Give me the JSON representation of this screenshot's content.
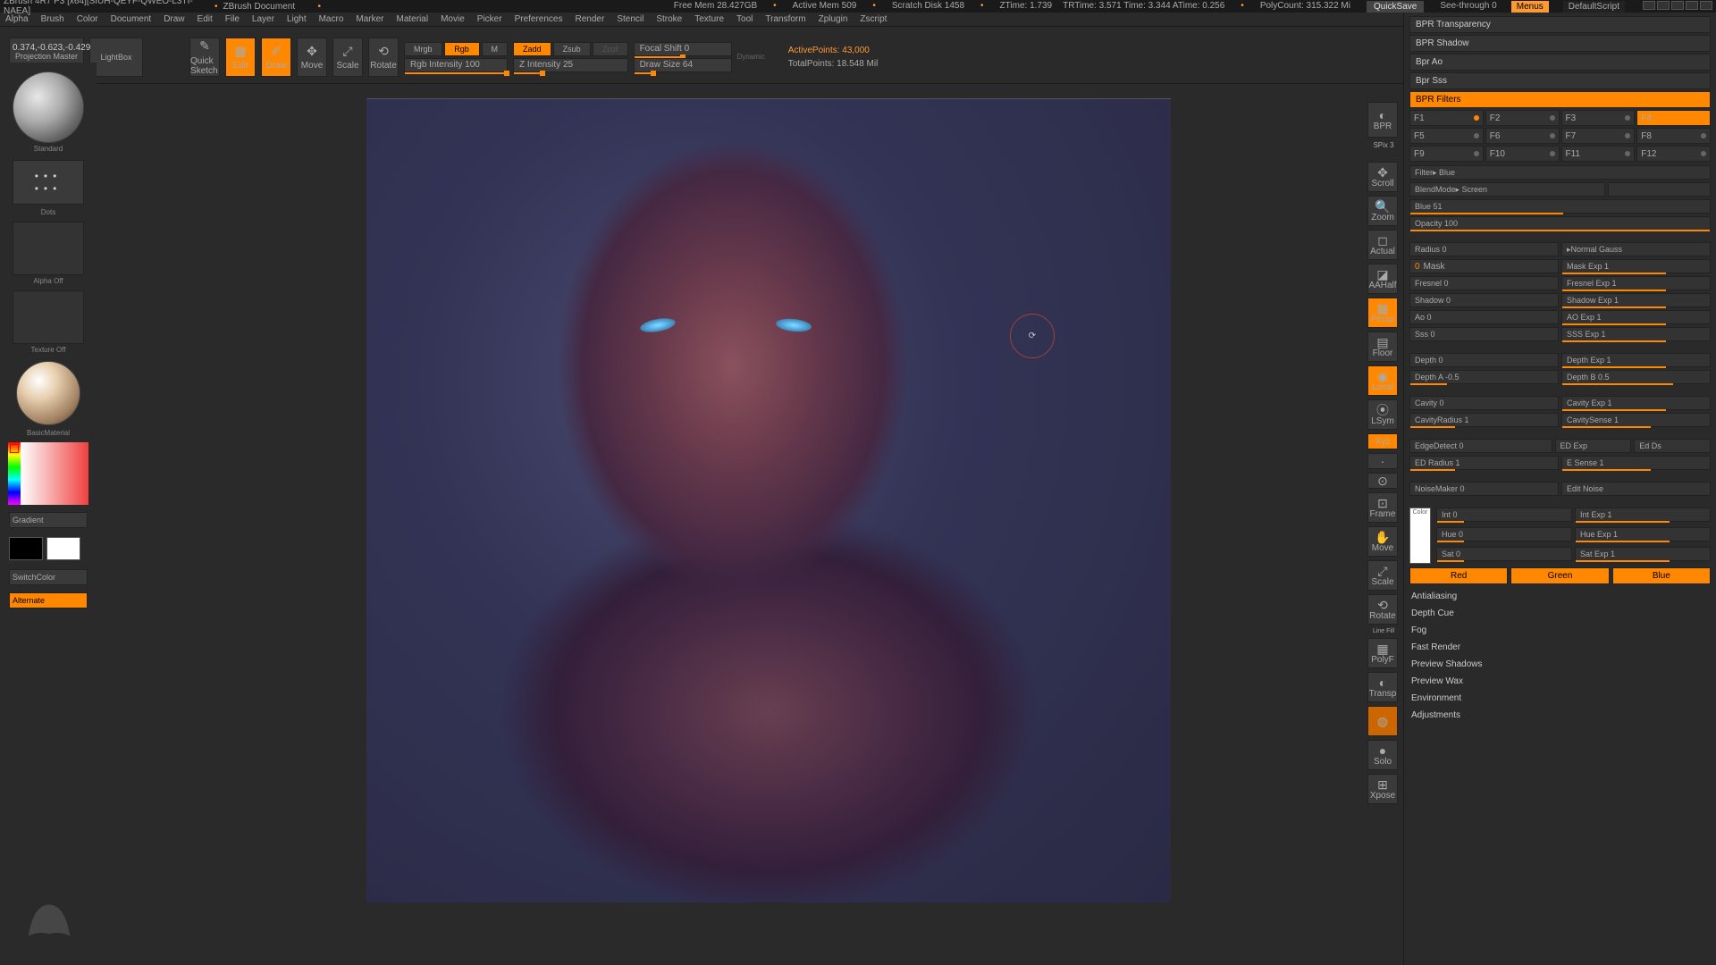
{
  "titlebar": {
    "app": "ZBrush 4R7 P3 [x64][SIUH-QEYF-QWEO-L3TI-NAEA]",
    "document": "ZBrush Document",
    "stats": {
      "freemem": "Free Mem 28.427GB",
      "activemem": "Active Mem 509",
      "scratch": "Scratch Disk 1458",
      "ztime": "ZTime: 1.739",
      "trtime": "TRTime: 3.571 Time: 3.344 ATime: 0.256",
      "polycount": "PolyCount: 315.322 Mi"
    },
    "quicksave": "QuickSave",
    "seethrough": "See-through  0",
    "menus": "Menus",
    "script": "DefaultScript"
  },
  "menubar": [
    "Alpha",
    "Brush",
    "Color",
    "Document",
    "Draw",
    "Edit",
    "File",
    "Layer",
    "Light",
    "Macro",
    "Marker",
    "Material",
    "Movie",
    "Picker",
    "Preferences",
    "Render",
    "Stencil",
    "Stroke",
    "Texture",
    "Tool",
    "Transform",
    "Zplugin",
    "Zscript"
  ],
  "readout": "0.374,-0.623,-0.429",
  "toolbar": {
    "projection": "Projection Master",
    "lightbox": "LightBox",
    "quicksketch": "Quick Sketch",
    "edit": "Edit",
    "draw": "Draw",
    "move": "Move",
    "scale": "Scale",
    "rotate": "Rotate",
    "mrgb": "Mrgb",
    "rgb": "Rgb",
    "m": "M",
    "rgbint": "Rgb Intensity 100",
    "zadd": "Zadd",
    "zsub": "Zsub",
    "zcut": "Zcut",
    "zint": "Z Intensity 25",
    "focal": "Focal Shift 0",
    "drawsize": "Draw Size 64",
    "dynamic": "Dynamic",
    "activepoints": "ActivePoints: 43,000",
    "totalpoints": "TotalPoints: 18.548 Mil"
  },
  "left": {
    "brush": "Standard",
    "stroke": "Dots",
    "alpha": "Alpha Off",
    "texture": "Texture Off",
    "material": "BasicMaterial",
    "gradient": "Gradient",
    "switchcolor": "SwitchColor",
    "alternate": "Alternate"
  },
  "rightside": {
    "bpr": "BPR",
    "spix": "SPix 3",
    "scroll": "Scroll",
    "zoom": "Zoom",
    "actual": "Actual",
    "aahalf": "AAHalf",
    "persp": "Persp",
    "floor": "Floor",
    "local": "Local",
    "lsym": "LSym",
    "xyz": "Xyz",
    "frame": "Frame",
    "move": "Move",
    "scale": "Scale",
    "rotate": "Rotate",
    "linefill": "Line Fill",
    "polyf": "PolyF",
    "transp": "Transp",
    "dynamic": "Dynamic",
    "solo": "Solo",
    "xpose": "Xpose"
  },
  "panel": {
    "bpr_transparency": "BPR Transparency",
    "bpr_shadow": "BPR Shadow",
    "bpr_ao": "Bpr Ao",
    "bpr_sss": "Bpr Sss",
    "bpr_filters": "BPR Filters",
    "filters": [
      "F1",
      "F2",
      "F3",
      "F4",
      "F5",
      "F6",
      "F7",
      "F8",
      "F9",
      "F10",
      "F11",
      "F12"
    ],
    "filter_label": "Filter▸ Blue",
    "blendmode": "BlendMode▸ Screen",
    "blue": "Blue 51",
    "opacity": "Opacity 100",
    "radius": "Radius 0",
    "normal": "▸Normal  Gauss",
    "mask": "Mask",
    "mask_exp": "Mask Exp 1",
    "fresnel": "Fresnel 0",
    "fresnel_exp": "Fresnel Exp 1",
    "shadow": "Shadow 0",
    "shadow_exp": "Shadow Exp 1",
    "ao": "Ao 0",
    "ao_exp": "AO Exp 1",
    "sss": "Sss 0",
    "sss_exp": "SSS Exp 1",
    "depth": "Depth 0",
    "depth_exp": "Depth Exp 1",
    "depth_a": "Depth A -0.5",
    "depth_b": "Depth B 0.5",
    "cavity": "Cavity 0",
    "cavity_exp": "Cavity Exp 1",
    "cavity_radius": "CavityRadius 1",
    "cavity_sense": "CavitySense 1",
    "edgedetect": "EdgeDetect 0",
    "ed_exp": "ED Exp",
    "ed_ds": "Ed Ds",
    "ed_radius": "ED Radius 1",
    "e_sense": "E Sense 1",
    "noisemaker": "NoiseMaker 0",
    "edit_noise": "Edit Noise",
    "int": "Int 0",
    "int_exp": "Int Exp 1",
    "hue": "Hue 0",
    "hue_exp": "Hue Exp 1",
    "sat": "Sat 0",
    "sat_exp": "Sat Exp 1",
    "red": "Red",
    "green": "Green",
    "blue_btn": "Blue",
    "antialiasing": "Antialiasing",
    "depthcue": "Depth Cue",
    "fog": "Fog",
    "fastrender": "Fast Render",
    "previewshadows": "Preview Shadows",
    "previewwax": "Preview Wax",
    "environment": "Environment",
    "adjustments": "Adjustments",
    "color_label": "Color"
  }
}
